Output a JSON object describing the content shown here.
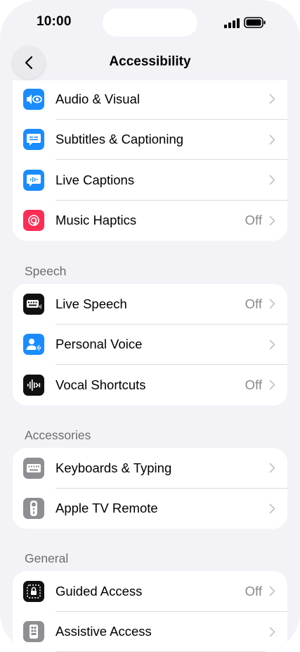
{
  "status": {
    "time": "10:00"
  },
  "nav": {
    "title": "Accessibility",
    "back_icon": "chevron-left-icon"
  },
  "colors": {
    "blue": "#1a8cff",
    "pink": "#ff2d55",
    "black": "#111111",
    "gray": "#8e8e93",
    "value_gray": "#8a8a8e"
  },
  "groups": {
    "hearing": {
      "rows": [
        {
          "label": "Audio & Visual",
          "value": "",
          "icon": "audio-visual-icon"
        },
        {
          "label": "Subtitles & Captioning",
          "value": "",
          "icon": "subtitles-icon"
        },
        {
          "label": "Live Captions",
          "value": "",
          "icon": "live-captions-icon"
        },
        {
          "label": "Music Haptics",
          "value": "Off",
          "icon": "music-haptics-icon"
        }
      ]
    },
    "speech": {
      "header": "Speech",
      "rows": [
        {
          "label": "Live Speech",
          "value": "Off",
          "icon": "keyboard-speech-icon"
        },
        {
          "label": "Personal Voice",
          "value": "",
          "icon": "personal-voice-icon"
        },
        {
          "label": "Vocal Shortcuts",
          "value": "Off",
          "icon": "waveform-icon"
        }
      ]
    },
    "accessories": {
      "header": "Accessories",
      "rows": [
        {
          "label": "Keyboards & Typing",
          "value": "",
          "icon": "keyboard-icon"
        },
        {
          "label": "Apple TV Remote",
          "value": "",
          "icon": "tv-remote-icon"
        }
      ]
    },
    "general": {
      "header": "General",
      "rows": [
        {
          "label": "Guided Access",
          "value": "Off",
          "icon": "guided-access-icon"
        },
        {
          "label": "Assistive Access",
          "value": "",
          "icon": "assistive-access-icon"
        }
      ]
    }
  }
}
